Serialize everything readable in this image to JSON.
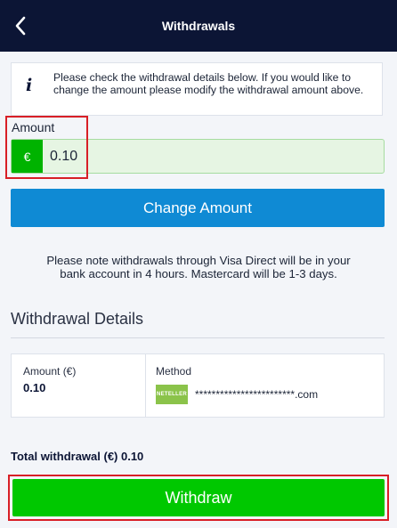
{
  "header": {
    "title": "Withdrawals",
    "back_icon": "chevron-left-icon"
  },
  "info": {
    "icon": "info-icon",
    "icon_glyph": "i",
    "text": "Please check the withdrawal details below. If you would like to change the amount please modify the withdrawal amount above."
  },
  "amount": {
    "label": "Amount",
    "currency_symbol": "€",
    "value": "0.10"
  },
  "change_amount_label": "Change Amount",
  "note": "Please note withdrawals through Visa Direct will be in your bank account in 4 hours. Mastercard will be 1-3 days.",
  "details": {
    "title": "Withdrawal Details",
    "amount_label": "Amount (€)",
    "amount_value": "0.10",
    "method_label": "Method",
    "method_logo_text": "NETELLER",
    "method_email": "************************.com"
  },
  "total": "Total withdrawal (€) 0.10",
  "withdraw_label": "Withdraw",
  "colors": {
    "header_bg": "#0c1535",
    "accent_blue": "#0f8ad4",
    "accent_green": "#00c800",
    "highlight_red": "#d81f26"
  }
}
